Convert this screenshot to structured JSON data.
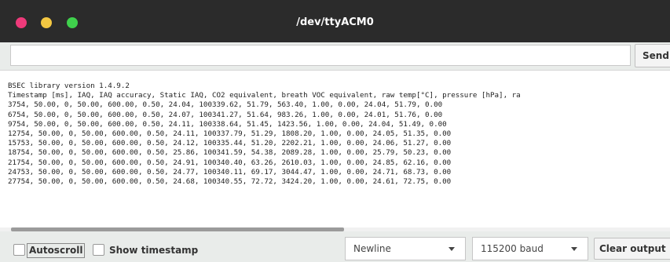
{
  "window": {
    "title": "/dev/ttyACM0",
    "controls": [
      {
        "name": "close-dot",
        "color": "#ee3a7a"
      },
      {
        "name": "minimize-dot",
        "color": "#f3c742"
      },
      {
        "name": "maximize-dot",
        "color": "#3fd14c"
      }
    ]
  },
  "input_bar": {
    "value": "",
    "placeholder": "",
    "send_label": "Send"
  },
  "output": {
    "lines": [
      "BSEC library version 1.4.9.2",
      "Timestamp [ms], IAQ, IAQ accuracy, Static IAQ, CO2 equivalent, breath VOC equivalent, raw temp[°C], pressure [hPa], ra",
      "3754, 50.00, 0, 50.00, 600.00, 0.50, 24.04, 100339.62, 51.79, 563.40, 1.00, 0.00, 24.04, 51.79, 0.00",
      "6754, 50.00, 0, 50.00, 600.00, 0.50, 24.07, 100341.27, 51.64, 983.26, 1.00, 0.00, 24.01, 51.76, 0.00",
      "9754, 50.00, 0, 50.00, 600.00, 0.50, 24.11, 100338.64, 51.45, 1423.56, 1.00, 0.00, 24.04, 51.49, 0.00",
      "12754, 50.00, 0, 50.00, 600.00, 0.50, 24.11, 100337.79, 51.29, 1808.20, 1.00, 0.00, 24.05, 51.35, 0.00",
      "15753, 50.00, 0, 50.00, 600.00, 0.50, 24.12, 100335.44, 51.20, 2202.21, 1.00, 0.00, 24.06, 51.27, 0.00",
      "18754, 50.00, 0, 50.00, 600.00, 0.50, 25.86, 100341.59, 54.38, 2089.28, 1.00, 0.00, 25.79, 50.23, 0.00",
      "21754, 50.00, 0, 50.00, 600.00, 0.50, 24.91, 100340.40, 63.26, 2610.03, 1.00, 0.00, 24.85, 62.16, 0.00",
      "24753, 50.00, 0, 50.00, 600.00, 0.50, 24.77, 100340.11, 69.17, 3044.47, 1.00, 0.00, 24.71, 68.73, 0.00",
      "27754, 50.00, 0, 50.00, 600.00, 0.50, 24.68, 100340.55, 72.72, 3424.20, 1.00, 0.00, 24.61, 72.75, 0.00"
    ]
  },
  "bottom_bar": {
    "autoscroll_label": "Autoscroll",
    "autoscroll_checked": false,
    "show_timestamp_label": "Show timestamp",
    "show_timestamp_checked": false,
    "line_ending": "Newline",
    "baud_rate": "115200 baud",
    "clear_label": "Clear output"
  }
}
